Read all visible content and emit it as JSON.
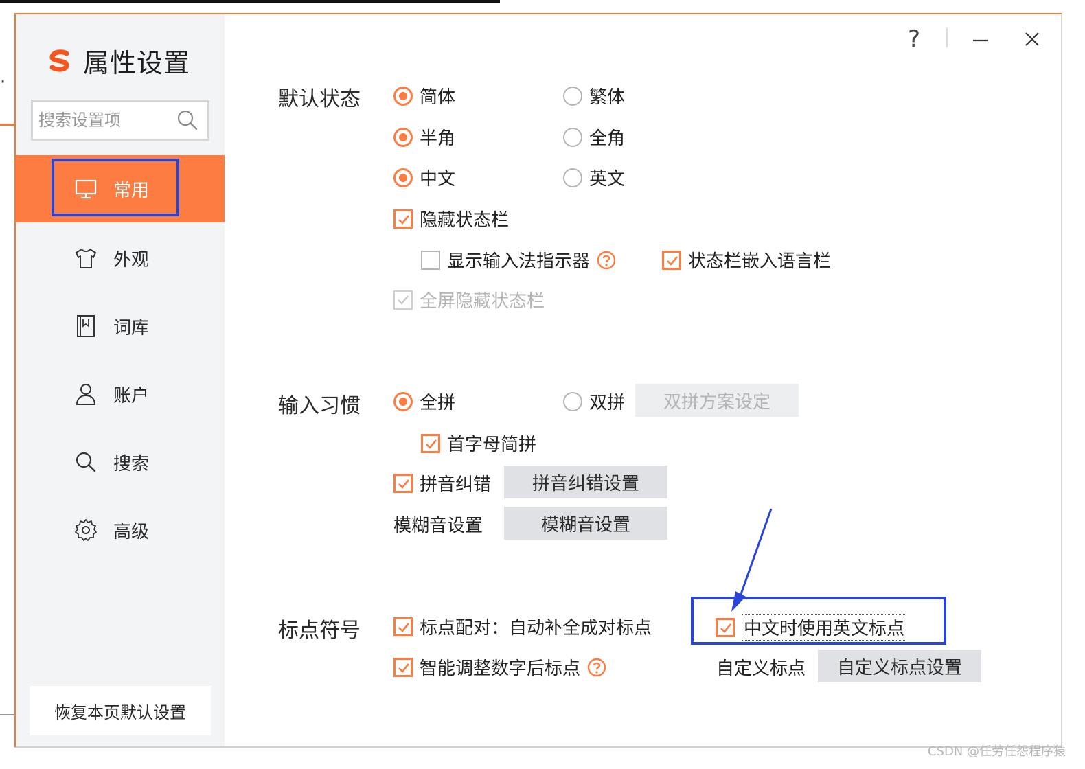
{
  "window": {
    "title": "属性设置"
  },
  "titlebar": {
    "help": "?"
  },
  "search": {
    "placeholder": "搜索设置项"
  },
  "sidebar": {
    "items": [
      {
        "label": "常用",
        "icon": "monitor-icon",
        "active": true
      },
      {
        "label": "外观",
        "icon": "shirt-icon"
      },
      {
        "label": "词库",
        "icon": "dictionary-icon"
      },
      {
        "label": "账户",
        "icon": "user-icon"
      },
      {
        "label": "搜索",
        "icon": "search-icon"
      },
      {
        "label": "高级",
        "icon": "gear-icon"
      }
    ],
    "restore_label": "恢复本页默认设置"
  },
  "default_state": {
    "title": "默认状态",
    "simplified": "简体",
    "traditional": "繁体",
    "half_width": "半角",
    "full_width": "全角",
    "chinese": "中文",
    "english": "英文",
    "hide_status_bar": "隐藏状态栏",
    "show_indicator": "显示输入法指示器",
    "embed_language_bar": "状态栏嵌入语言栏",
    "fullscreen_hide": "全屏隐藏状态栏"
  },
  "input_habit": {
    "title": "输入习惯",
    "full_pinyin": "全拼",
    "double_pinyin": "双拼",
    "double_scheme_button": "双拼方案设定",
    "initial_abbrev": "首字母简拼",
    "pinyin_correction": "拼音纠错",
    "pinyin_correction_button": "拼音纠错设置",
    "fuzzy_label": "模糊音设置",
    "fuzzy_button": "模糊音设置"
  },
  "punctuation": {
    "title": "标点符号",
    "auto_pair": "标点配对：自动补全成对标点",
    "english_punct_in_chinese": "中文时使用英文标点",
    "smart_adjust": "智能调整数字后标点",
    "custom_label": "自定义标点",
    "custom_button": "自定义标点设置"
  },
  "colors": {
    "accent": "#fd7c41",
    "highlight_box": "#2a45d6"
  },
  "watermark": "CSDN @任劳任怨程序猿"
}
